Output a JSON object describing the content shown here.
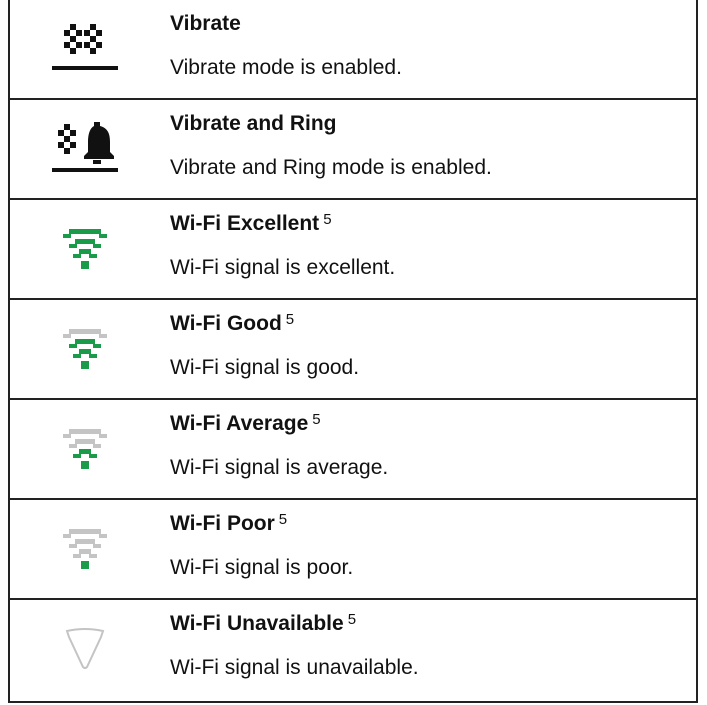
{
  "rows": [
    {
      "icon": "vibrate-icon",
      "title": "Vibrate",
      "note": "",
      "desc": "Vibrate mode is enabled."
    },
    {
      "icon": "vibrate-and-ring-icon",
      "title": "Vibrate and Ring",
      "note": "",
      "desc": "Vibrate and Ring mode is enabled."
    },
    {
      "icon": "wifi-excellent-icon",
      "title": "Wi-Fi Excellent",
      "note": "5",
      "desc": "Wi-Fi signal is excellent.",
      "level": 4
    },
    {
      "icon": "wifi-good-icon",
      "title": "Wi-Fi Good",
      "note": "5",
      "desc": "Wi-Fi signal is good.",
      "level": 3
    },
    {
      "icon": "wifi-average-icon",
      "title": "Wi-Fi Average",
      "note": "5",
      "desc": "Wi-Fi signal is average.",
      "level": 2
    },
    {
      "icon": "wifi-poor-icon",
      "title": "Wi-Fi Poor",
      "note": "5",
      "desc": "Wi-Fi signal is poor.",
      "level": 1
    },
    {
      "icon": "wifi-unavailable-icon",
      "title": "Wi-Fi Unavailable",
      "note": "5",
      "desc": "Wi-Fi signal is unavailable.",
      "level": 0
    }
  ],
  "colors": {
    "wifi_on": "#1a9b4a",
    "wifi_off": "#c4c4c4",
    "icon_dark": "#111111"
  }
}
